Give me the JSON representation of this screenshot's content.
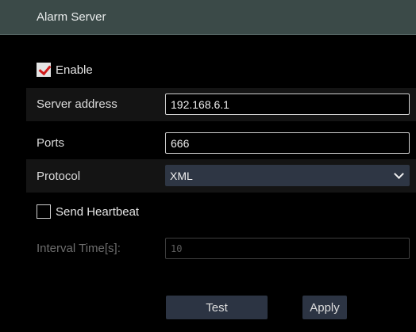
{
  "header": {
    "title": "Alarm Server"
  },
  "enable": {
    "label": "Enable",
    "checked": true
  },
  "server_address": {
    "label": "Server address",
    "value": "192.168.6.1"
  },
  "ports": {
    "label": "Ports",
    "value": "666"
  },
  "protocol": {
    "label": "Protocol",
    "value": "XML"
  },
  "heartbeat": {
    "label": "Send Heartbeat",
    "checked": false
  },
  "interval": {
    "label": "Interval Time[s]:",
    "value": "10"
  },
  "buttons": {
    "test": "Test",
    "apply": "Apply"
  },
  "colors": {
    "header_bg": "#3b4a48",
    "row_band": "#141414",
    "select_bg": "#2e3644",
    "button_bg": "#2c3443",
    "check_accent": "#d11b1b"
  },
  "icons": {
    "enable_check": "checkmark-icon",
    "protocol_dropdown": "chevron-down-icon"
  }
}
